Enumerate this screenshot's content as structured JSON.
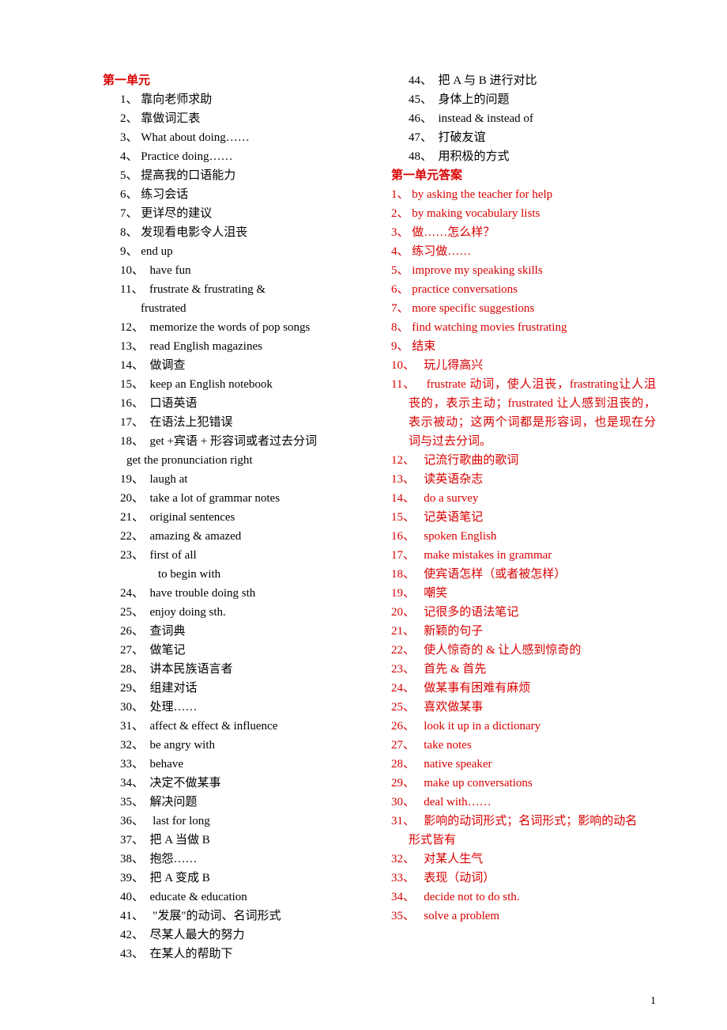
{
  "unit1_heading": "第一单元",
  "q": {
    "1": "靠向老师求助",
    "2": "靠做词汇表",
    "3": "What about doing……",
    "4": "Practice doing……",
    "5": "提高我的口语能力",
    "6": "练习会话",
    "7": "更详尽的建议",
    "8": "发现看电影令人沮丧",
    "9": "end up",
    "10": "have fun",
    "11": "frustrate & frustrating & frustrated",
    "11a": "frustrate  &  frustrating  &",
    "11b": "frustrated",
    "12": "memorize the words of pop songs",
    "13": "read English magazines",
    "14": "做调查",
    "15": "keep an English notebook",
    "16": "口语英语",
    "17": "在语法上犯错误",
    "18": "get +宾语 + 形容词或者过去分词",
    "18b": "get the pronunciation right",
    "19": "laugh at",
    "20": "take a lot of grammar notes",
    "21": "original sentences",
    "22": "amazing & amazed",
    "23": "first of all",
    "23b": "to begin with",
    "24": "have trouble doing sth",
    "25": "enjoy doing sth.",
    "26": "查词典",
    "27": "做笔记",
    "28": "讲本民族语言者",
    "29": "组建对话",
    "30": "处理……",
    "31": "affect & effect & influence",
    "32": "be angry with",
    "33": "behave",
    "34": "决定不做某事",
    "35": "解决问题",
    "36": " last for long",
    "37": "把 A 当做 B",
    "38": "抱怨……",
    "39": "把 A 变成 B",
    "40": "educate & education",
    "41": " \"发展\"的动词、名词形式",
    "42": "尽某人最大的努力",
    "43": "在某人的帮助下",
    "44": "把 A 与 B 进行对比",
    "45": "身体上的问题",
    "46": "instead & instead of",
    "47": "打破友谊",
    "48": "用积极的方式"
  },
  "answers_heading": "第一单元答案",
  "a": {
    "1": "by asking the teacher for help",
    "2": "by making vocabulary lists",
    "3": "做……怎么样？",
    "4": "练习做……",
    "5": "improve my speaking skills",
    "6": "practice conversations",
    "7": "more specific suggestions",
    "8": "find watching movies frustrating",
    "9": "结束",
    "10": "玩儿得高兴",
    "11": "frustrate 动词，使人沮丧，frastrating让人沮丧的，表示主动；frustrated 让人感到沮丧的，表示被动；这两个词都是形容词，也是现在分词与过去分词。",
    "12": "记流行歌曲的歌词",
    "13": "读英语杂志",
    "14": "do a survey",
    "15": "记英语笔记",
    "16": "spoken English",
    "17": "make mistakes in grammar",
    "18": "使宾语怎样（或者被怎样）",
    "19": "嘲笑",
    "20": "记很多的语法笔记",
    "21": "新颖的句子",
    "22": "使人惊奇的 & 让人感到惊奇的",
    "23": "首先 & 首先",
    "24": "做某事有困难有麻烦",
    "25": "喜欢做某事",
    "26": "look it up in a dictionary",
    "27": "take notes",
    "28": "native speaker",
    "29": "make up conversations",
    "30": "deal with……",
    "31": "影响的动词形式；名词形式；影响的动名形式皆有",
    "31a": "影响的动词形式；名词形式；影响的动名",
    "31b": "形式皆有",
    "32": "对某人生气",
    "33": "表现（动词）",
    "34": "decide not to do sth.",
    "35": "solve a problem"
  },
  "pagenum": "1"
}
